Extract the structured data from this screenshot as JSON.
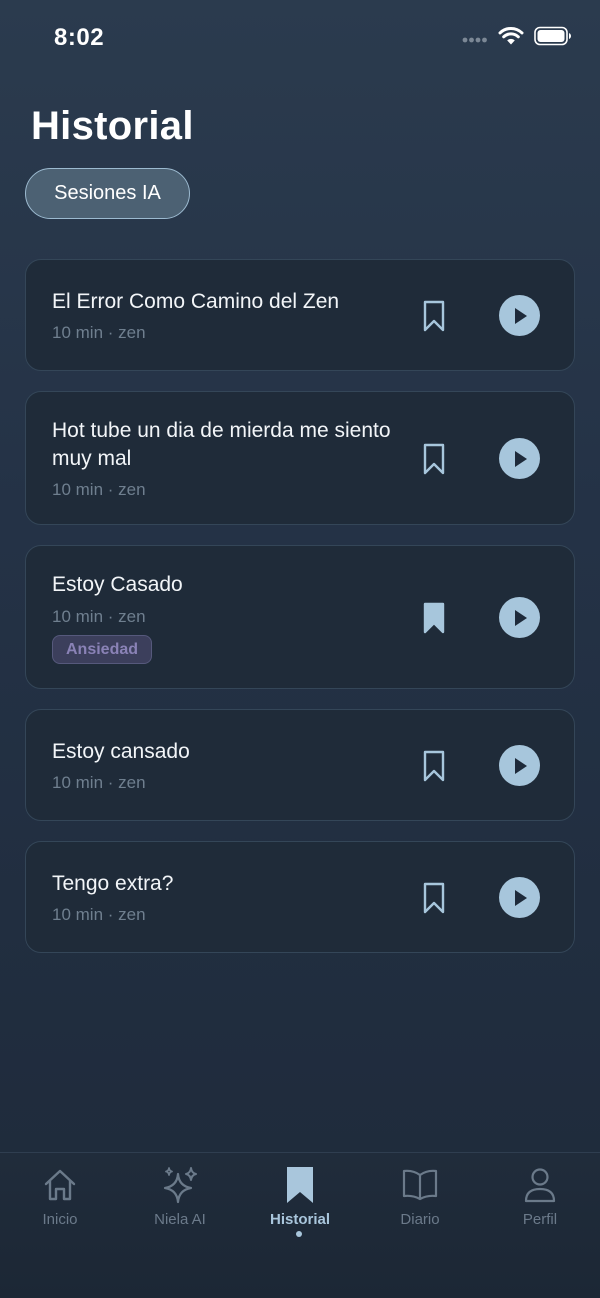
{
  "status_bar": {
    "time": "8:02"
  },
  "header": {
    "title": "Historial"
  },
  "filter": {
    "label": "Sesiones IA"
  },
  "colors": {
    "accent": "#a7c6dc",
    "tag_text": "#8a82b6",
    "muted": "#6f7f8f"
  },
  "sessions": [
    {
      "title": "El Error Como Camino del Zen",
      "meta": "10 min · zen",
      "saved": false
    },
    {
      "title": "Hot tube un dia de mierda me siento muy mal",
      "meta": "10 min · zen",
      "saved": false
    },
    {
      "title": "Estoy Casado",
      "meta": "10 min · zen",
      "tag": "Ansiedad",
      "saved": true
    },
    {
      "title": "Estoy cansado",
      "meta": "10 min · zen",
      "saved": false
    },
    {
      "title": "Tengo extra?",
      "meta": "10 min · zen",
      "saved": false
    }
  ],
  "tabs": [
    {
      "label": "Inicio",
      "icon": "home-icon"
    },
    {
      "label": "Niela AI",
      "icon": "sparkles-icon"
    },
    {
      "label": "Historial",
      "icon": "bookmark-icon",
      "active": true
    },
    {
      "label": "Diario",
      "icon": "book-icon"
    },
    {
      "label": "Perfil",
      "icon": "user-icon"
    }
  ]
}
